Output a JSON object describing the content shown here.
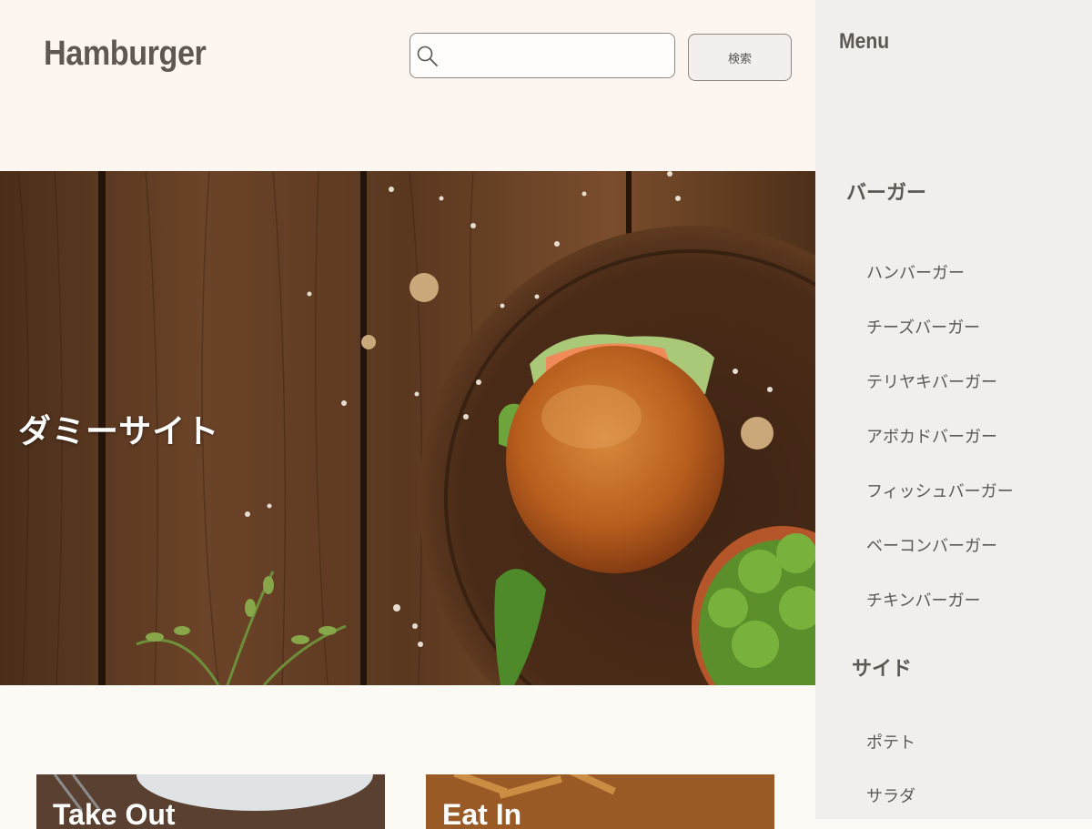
{
  "header": {
    "logo": "Hamburger",
    "search": {
      "value": "",
      "placeholder": ""
    },
    "search_button_label": "検索"
  },
  "hero": {
    "title": "ダミーサイト"
  },
  "cards": [
    {
      "label": "Take Out"
    },
    {
      "label": "Eat In"
    }
  ],
  "sidebar": {
    "title": "Menu",
    "sections": [
      {
        "heading": "バーガー",
        "items": [
          "ハンバーガー",
          "チーズバーガー",
          "テリヤキバーガー",
          "アボカドバーガー",
          "フィッシュバーガー",
          "ベーコンバーガー",
          "チキンバーガー"
        ]
      },
      {
        "heading": "サイド",
        "items": [
          "ポテト",
          "サラダ"
        ]
      }
    ]
  },
  "colors": {
    "header_bg": "#fdf5f0",
    "sidebar_bg": "#f2eeeb",
    "text": "#5e5853"
  }
}
